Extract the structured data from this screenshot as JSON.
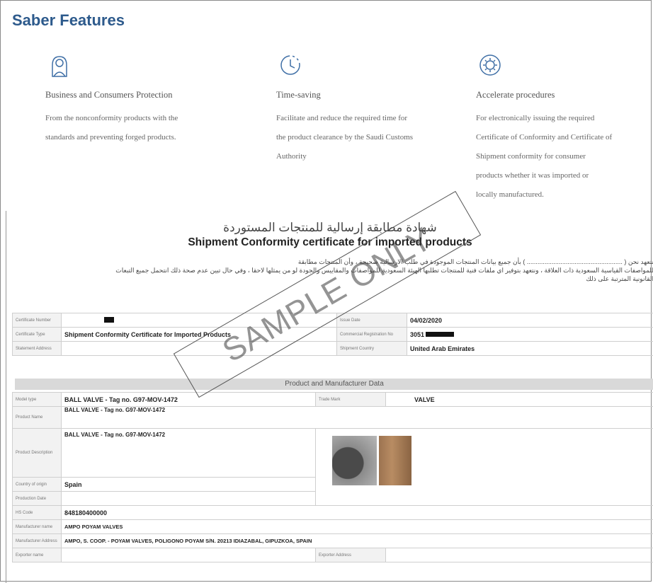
{
  "page_title": "Saber Features",
  "features": [
    {
      "icon": "person-shield-icon",
      "title": "Business and Consumers Protection",
      "lines": [
        "From the nonconformity products with the",
        "standards and preventing forged products."
      ]
    },
    {
      "icon": "clock-icon",
      "title": "Time-saving",
      "lines": [
        "Facilitate and reduce the required time for",
        "the product clearance by the Saudi Customs",
        "Authority"
      ]
    },
    {
      "icon": "gear-cycle-icon",
      "title": "Accelerate procedures",
      "lines": [
        "For electronically issuing the required",
        "Certificate of Conformity and Certificate of",
        "Shipment conformity for consumer",
        "products whether it was imported or",
        "locally manufactured."
      ]
    }
  ],
  "certificate": {
    "ar_title": "شهادة مطابقة إرسالية للمنتجات المستوردة",
    "en_title": "Shipment Conformity certificate for imported products",
    "ar_para": [
      "نتعهد نحن ( ...................................................... ) بأن جميع بيانات المنتجات الموجودة في طلب الارسالية صحيحة ، وأن المنتجات مطابقة",
      "للمواصفات القياسية السعودية ذات العلاقة ، ونتعهد بتوفير اي ملفات فنية للمنتجات تطلبها الهيئة السعودية للمواصفات والمقاييس والجودة لو من يمثلها لاحقا ، وفي حال تبين عدم صحة ذلك انتحمل جميع التبعات",
      "القانونية المترتبة على ذلك"
    ],
    "labels": {
      "certificate_number": "Certificate Number",
      "certificate_type": "Certificate Type",
      "statement_address": "Statement Address",
      "issue_date": "Issue Date",
      "commercial_reg_no": "Commercial Registration No",
      "shipment_country": "Shipment Country",
      "model_type": "Model type",
      "product_name": "Product Name",
      "product_description": "Product Description",
      "country_of_origin": "Country of origin",
      "production_date": "Production Date",
      "hs_code": "HS Code",
      "manufacturer_name": "Manufacturer name",
      "manufacturer_address": "Manufacturer Address",
      "exporter_name": "Exporter name",
      "trade_mark": "Trade Mark",
      "exporter_address": "Exporter Address"
    },
    "values": {
      "certificate_type": "Shipment Conformity Certificate for Imported Products",
      "issue_date": "04/02/2020",
      "commercial_reg_no": "3051",
      "shipment_country": "United Arab Emirates",
      "model_type": "BALL VALVE - Tag no. G97-MOV-1472",
      "trade_mark": "VALVE",
      "product_name": "BALL VALVE - Tag no. G97-MOV-1472",
      "product_description": "BALL VALVE - Tag no. G97-MOV-1472",
      "country_of_origin": "Spain",
      "hs_code": "848180400000",
      "manufacturer_name": "AMPO POYAM VALVES",
      "manufacturer_address": "AMPO, S. COOP. - POYAM VALVES, POLIGONO POYAM S/N. 20213 IDIAZABAL, GIPUZKOA, SPAIN"
    },
    "section_header": "Product and Manufacturer Data"
  },
  "watermark": "SAMPLE ONLY",
  "colors": {
    "title": "#2d5a8c",
    "icon": "#3f6fa6"
  }
}
